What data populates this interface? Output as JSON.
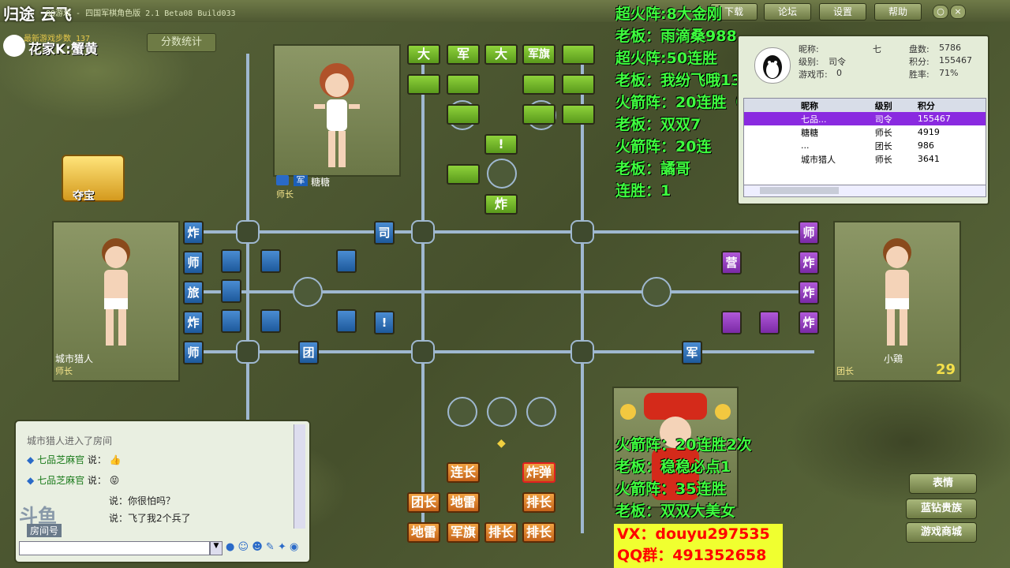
{
  "window": {
    "corner_title": "归途 云飞",
    "title": "QQ游戏 - 四国军棋角色版 2.1 Beta08 Build033",
    "buttons": [
      "下载",
      "论坛",
      "设置",
      "帮助"
    ],
    "controls": [
      "○",
      "×"
    ]
  },
  "overlay_top": {
    "score_button": "分数统计",
    "fan_label": "花家K:蟹黄",
    "new_hint": "最新游戏步数 137",
    "lines": [
      "超火阵:8大金刚",
      "老板：雨滴桑988",
      "超火阵:50连胜",
      "老板：我纷飞哦13",
      "火箭阵：20连胜（阿7+双）",
      "老板：双双7",
      "火箭阵：20连",
      "老板：譎哥",
      "连胜：1"
    ]
  },
  "overlay_bottom": {
    "lines": [
      "火箭阵：20连胜2次",
      "老板：稳稳必点1",
      "火箭阵：35连胜",
      "老板：双双大美女"
    ],
    "vx": "VX：douyu297535",
    "qq": "QQ群：491352658"
  },
  "treasure": {
    "label": "夺宝"
  },
  "players": {
    "top": {
      "badge": "军",
      "name": "糖糖",
      "rank": "师长"
    },
    "left": {
      "name": "城市猎人",
      "rank": "师长"
    },
    "right": {
      "name": "小鶏",
      "rank": "团长",
      "count": "29"
    }
  },
  "info_panel": {
    "nickname_label": "昵称:",
    "nickname": "七",
    "level_label": "级别:",
    "level": "司令",
    "coins_label": "游戏币:",
    "coins": "0",
    "games_label": "盘数:",
    "games": "5786",
    "score_label": "积分:",
    "score": "155467",
    "winrate_label": "胜率:",
    "winrate": "71%",
    "table_headers": [
      "昵称",
      "级别",
      "积分"
    ],
    "rows": [
      {
        "name": "七品...",
        "level": "司令",
        "score": "155467"
      },
      {
        "name": "糖糖",
        "level": "师长",
        "score": "4919"
      },
      {
        "name": "...",
        "level": "团长",
        "score": "986"
      },
      {
        "name": "城市猎人",
        "level": "师长",
        "score": "3641"
      }
    ]
  },
  "board": {
    "top_pieces": [
      "大",
      "军",
      "大",
      "军旗",
      "",
      "",
      "",
      "",
      "",
      "",
      "",
      "",
      "",
      "",
      "!",
      "",
      "炸"
    ],
    "left_pieces": [
      "炸",
      "师",
      "旅",
      "炸",
      "师",
      "司",
      "团",
      "!"
    ],
    "right_pieces": [
      "师",
      "炸",
      "炸",
      "营",
      "军",
      "炸"
    ],
    "bottom_pieces": [
      "连长",
      "炸弹",
      "团长",
      "地雷",
      "排长",
      "地雷",
      "军旗",
      "排长",
      "排长"
    ]
  },
  "chat": {
    "messages": [
      {
        "text": "城市猎人进入了房间"
      },
      {
        "name": "七品芝麻官",
        "says": "说：",
        "emoji": "👍"
      },
      {
        "name": "七品芝麻官",
        "says": "说：",
        "emoji": "😝"
      },
      {
        "text": "说：你很怕吗？"
      },
      {
        "text": "说：飞了我2个兵了"
      }
    ],
    "room_label": "房间号",
    "watermark": "斗鱼"
  },
  "right_buttons": [
    "表情",
    "蓝钻贵族",
    "游戏商城"
  ]
}
